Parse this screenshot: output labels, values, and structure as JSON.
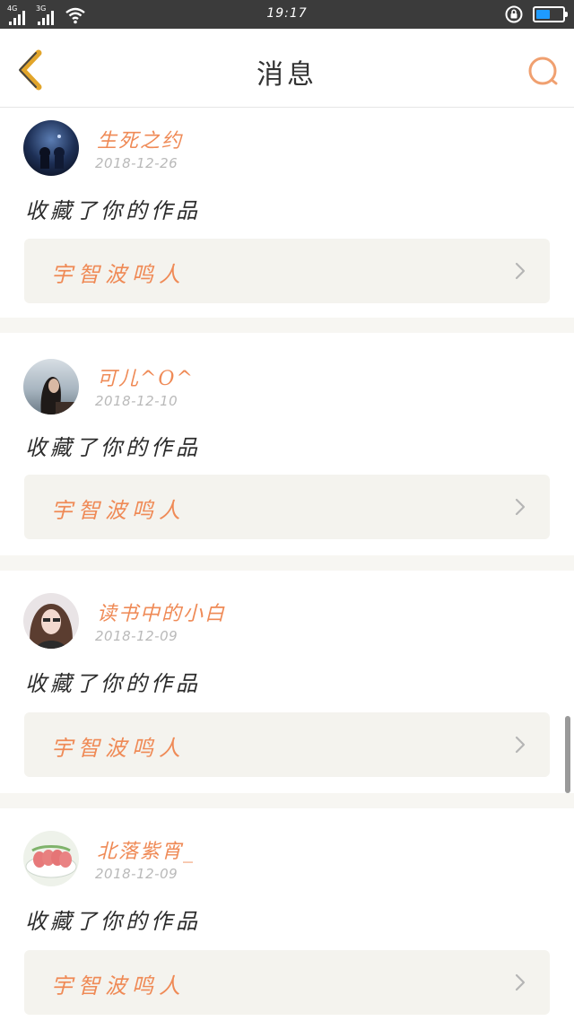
{
  "status_bar": {
    "time": "19:17",
    "network_left": "4G",
    "network_right": "3G",
    "battery_level": 0.55,
    "battery_color": "#1e9bff"
  },
  "nav": {
    "title": "消息",
    "back_icon": "chevron-left-icon",
    "search_icon": "search-icon",
    "back_color": "#e2a52a",
    "search_color": "#f0a070"
  },
  "messages": [
    {
      "username": "生死之约",
      "date": "2018-12-26",
      "action": "收藏了你的作品",
      "work": "宇智波鸣人"
    },
    {
      "username": "可儿^O^",
      "date": "2018-12-10",
      "action": "收藏了你的作品",
      "work": "宇智波鸣人"
    },
    {
      "username": "读书中的小白",
      "date": "2018-12-09",
      "action": "收藏了你的作品",
      "work": "宇智波鸣人"
    },
    {
      "username": "北落紫宵_",
      "date": "2018-12-09",
      "action": "收藏了你的作品",
      "work": "宇智波鸣人"
    }
  ],
  "colors": {
    "accent": "#ef8a56",
    "card_bg": "#f4f3ee",
    "separator": "#f7f6f2"
  }
}
